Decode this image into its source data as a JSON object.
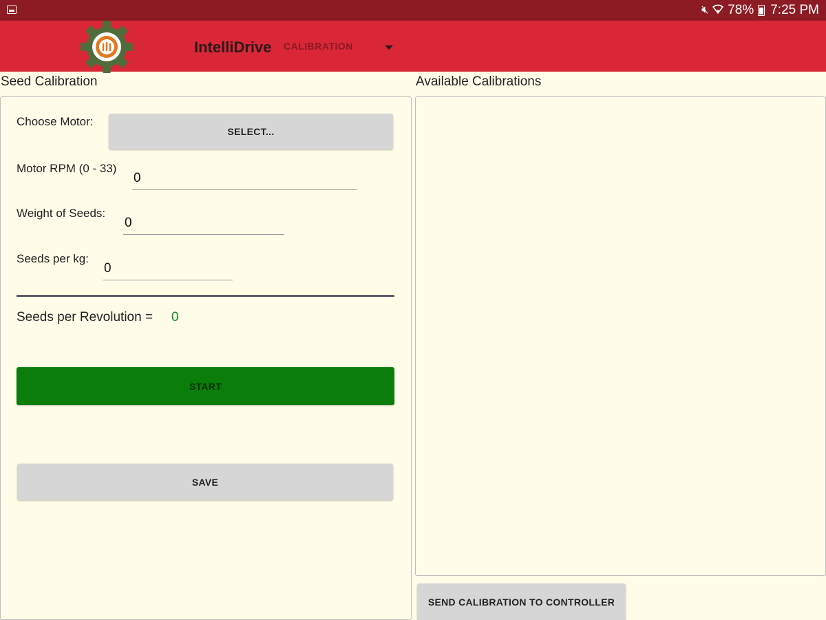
{
  "status_bar": {
    "battery_percent": "78%",
    "time": "7:25 PM",
    "icons": [
      "screenshot-icon",
      "mute-icon",
      "wifi-icon",
      "battery-charging-icon"
    ]
  },
  "app_bar": {
    "title": "IntelliDrive",
    "nav_spinner_value": "CALIBRATION",
    "logo": "gear-seed-logo"
  },
  "seed_calibration": {
    "title": "Seed Calibration",
    "choose_motor_label": "Choose Motor:",
    "select_button": "SELECT...",
    "motor_rpm_label": "Motor RPM (0 - 33)",
    "motor_rpm_value": "0",
    "weight_label": "Weight of Seeds:",
    "weight_value": "0",
    "seeds_per_kg_label": "Seeds per kg:",
    "seeds_per_kg_value": "0",
    "seeds_per_rev_label": "Seeds per Revolution =",
    "seeds_per_rev_value": "0",
    "start_button": "START",
    "save_button": "SAVE"
  },
  "available_calibrations": {
    "title": "Available Calibrations",
    "items": [],
    "send_button": "SEND CALIBRATION TO CONTROLLER"
  },
  "colors": {
    "status_bar": "#8c1b24",
    "app_bar": "#d92738",
    "background": "#fffde8",
    "start_button": "#0a7d0a",
    "result_value": "#1a8a2a"
  }
}
